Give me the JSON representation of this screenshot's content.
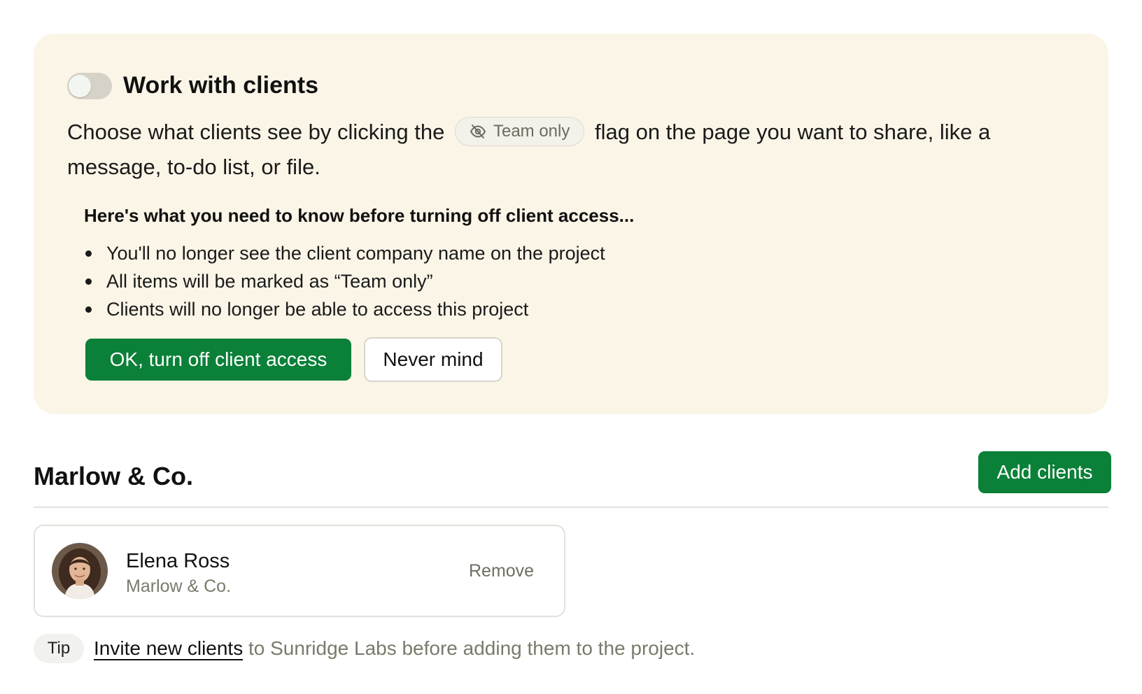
{
  "panel": {
    "title": "Work with clients",
    "toggle_on": false,
    "desc_before": "Choose what clients see by clicking the",
    "flag_label": "Team only",
    "flag_icon": "eye-slash-icon",
    "desc_after": "flag on the page you want to share, like a message, to-do list, or file.",
    "warning_title": "Here's what you need to know before turning off client access...",
    "warning_items": [
      "You'll no longer see the client company name on the project",
      "All items will be marked as “Team only”",
      "Clients will no longer be able to access this project"
    ],
    "confirm_label": "OK, turn off client access",
    "cancel_label": "Never mind"
  },
  "section": {
    "title": "Marlow & Co.",
    "add_label": "Add clients"
  },
  "clients": [
    {
      "name": "Elena Ross",
      "company": "Marlow & Co.",
      "remove_label": "Remove"
    }
  ],
  "tip": {
    "badge": "Tip",
    "link_text": "Invite new clients",
    "rest_text": "to Sunridge Labs before adding them to the project."
  },
  "colors": {
    "panel_bg": "#fbf5e7",
    "primary_green": "#0a8038",
    "muted_text": "#7a7a6c"
  }
}
